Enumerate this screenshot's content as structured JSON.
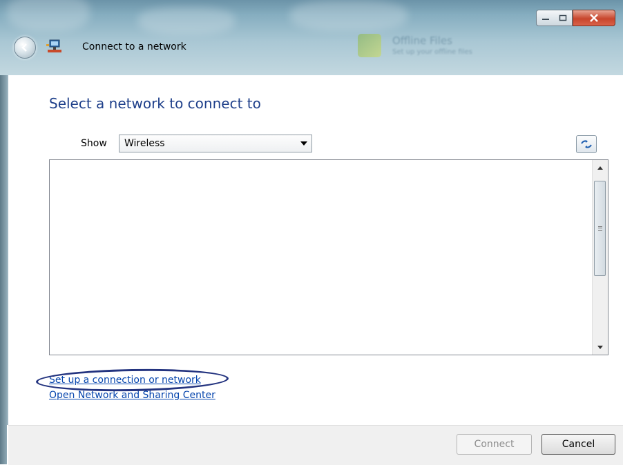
{
  "window": {
    "title": "Connect to a network",
    "background_hint_title": "Offline Files",
    "background_hint_sub": "Set up your offline files"
  },
  "main": {
    "heading": "Select a network to connect to",
    "show_label": "Show",
    "show_value": "Wireless",
    "network_list": []
  },
  "links": {
    "setup": "Set up a connection or network",
    "sharing_center": "Open Network and Sharing Center"
  },
  "buttons": {
    "connect": "Connect",
    "cancel": "Cancel"
  },
  "colors": {
    "heading": "#1e3f8a",
    "link": "#0645ad",
    "highlight_ellipse": "#23337f"
  },
  "icons": [
    "back-arrow-icon",
    "network-icon",
    "minimize-icon",
    "maximize-icon",
    "close-icon",
    "refresh-icon"
  ]
}
